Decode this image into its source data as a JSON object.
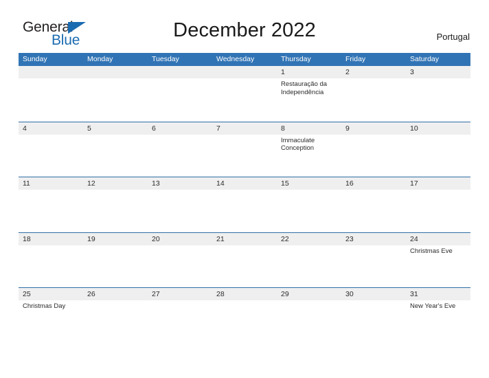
{
  "brand": {
    "name_line1": "General",
    "name_line2": "Blue",
    "flag_icon": "triangle-flag-icon",
    "color_dark": "#231f20",
    "color_blue": "#1b6bb0"
  },
  "header": {
    "title": "December 2022",
    "country": "Portugal"
  },
  "colors": {
    "header_blue": "#3174b5",
    "row_separator": "#2e6da4",
    "band_gray": "#efeff0",
    "text": "#2b2b2b"
  },
  "calendar": {
    "month": "December",
    "year": "2022",
    "weekday_headers": [
      "Sunday",
      "Monday",
      "Tuesday",
      "Wednesday",
      "Thursday",
      "Friday",
      "Saturday"
    ],
    "weeks": [
      [
        {
          "date": "",
          "events": []
        },
        {
          "date": "",
          "events": []
        },
        {
          "date": "",
          "events": []
        },
        {
          "date": "",
          "events": []
        },
        {
          "date": "1",
          "events": [
            "Restauração da Independência"
          ]
        },
        {
          "date": "2",
          "events": []
        },
        {
          "date": "3",
          "events": []
        }
      ],
      [
        {
          "date": "4",
          "events": []
        },
        {
          "date": "5",
          "events": []
        },
        {
          "date": "6",
          "events": []
        },
        {
          "date": "7",
          "events": []
        },
        {
          "date": "8",
          "events": [
            "Immaculate Conception"
          ]
        },
        {
          "date": "9",
          "events": []
        },
        {
          "date": "10",
          "events": []
        }
      ],
      [
        {
          "date": "11",
          "events": []
        },
        {
          "date": "12",
          "events": []
        },
        {
          "date": "13",
          "events": []
        },
        {
          "date": "14",
          "events": []
        },
        {
          "date": "15",
          "events": []
        },
        {
          "date": "16",
          "events": []
        },
        {
          "date": "17",
          "events": []
        }
      ],
      [
        {
          "date": "18",
          "events": []
        },
        {
          "date": "19",
          "events": []
        },
        {
          "date": "20",
          "events": []
        },
        {
          "date": "21",
          "events": []
        },
        {
          "date": "22",
          "events": []
        },
        {
          "date": "23",
          "events": []
        },
        {
          "date": "24",
          "events": [
            "Christmas Eve"
          ]
        }
      ],
      [
        {
          "date": "25",
          "events": [
            "Christmas Day"
          ]
        },
        {
          "date": "26",
          "events": []
        },
        {
          "date": "27",
          "events": []
        },
        {
          "date": "28",
          "events": []
        },
        {
          "date": "29",
          "events": []
        },
        {
          "date": "30",
          "events": []
        },
        {
          "date": "31",
          "events": [
            "New Year's Eve"
          ]
        }
      ]
    ]
  }
}
